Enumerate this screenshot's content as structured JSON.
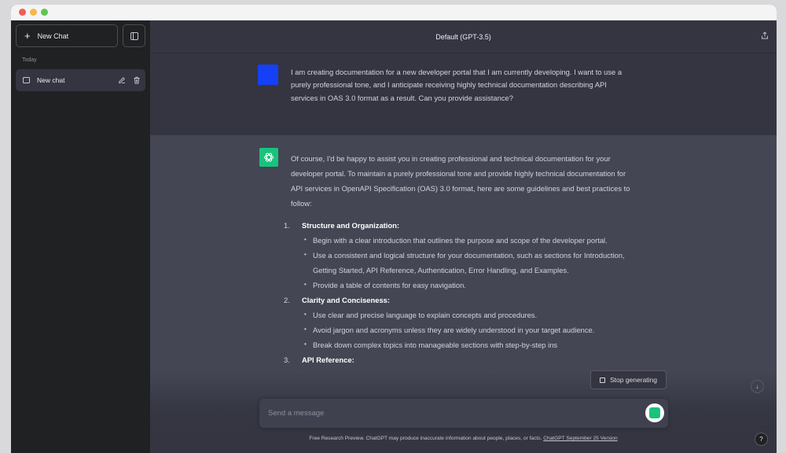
{
  "window": {
    "traffic_lights": [
      "close",
      "minimize",
      "zoom"
    ]
  },
  "sidebar": {
    "new_chat_label": "New Chat",
    "section_label": "Today",
    "chats": [
      {
        "label": "New chat"
      }
    ],
    "icons": {
      "new_chat": "plus-icon",
      "toggle": "sidebar-toggle-icon",
      "chat": "chat-bubble-icon",
      "edit": "pencil-icon",
      "delete": "trash-icon"
    }
  },
  "header": {
    "title": "Default (GPT-3.5)",
    "share_icon": "share-icon"
  },
  "conversation": {
    "user_message": "I am creating documentation for a new developer portal that I am currently developing. I want to use a purely professional tone, and I anticipate receiving highly technical documentation describing API services in OAS 3.0 format as a result. Can you provide assistance?",
    "assistant_intro": "Of course, I'd be happy to assist you in creating professional and technical documentation for your developer portal. To maintain a purely professional tone and provide highly technical documentation for API services in OpenAPI Specification (OAS) 3.0 format, here are some guidelines and best practices to follow:",
    "sections": [
      {
        "number": "1.",
        "heading": "Structure and Organization:",
        "bullets": [
          "Begin with a clear introduction that outlines the purpose and scope of the developer portal.",
          "Use a consistent and logical structure for your documentation, such as sections for Introduction, Getting Started, API Reference, Authentication, Error Handling, and Examples.",
          "Provide a table of contents for easy navigation."
        ]
      },
      {
        "number": "2.",
        "heading": "Clarity and Conciseness:",
        "bullets": [
          "Use clear and precise language to explain concepts and procedures.",
          "Avoid jargon and acronyms unless they are widely understood in your target audience.",
          "Break down complex topics into manageable sections with step-by-step ins"
        ]
      },
      {
        "number": "3.",
        "heading": "API Reference:",
        "bullets": []
      }
    ]
  },
  "controls": {
    "stop_label": "Stop generating",
    "composer_placeholder": "Send a message",
    "scroll_down_icon": "arrow-down-icon",
    "help_label": "?"
  },
  "footer": {
    "text": "Free Research Preview. ChatGPT may produce inaccurate information about people, places, or facts.",
    "link": "ChatGPT September 25 Version"
  },
  "colors": {
    "sidebar": "#202123",
    "main": "#343541",
    "assistant_bg": "#444654",
    "user_avatar": "#1540f5",
    "bot_avatar": "#19c37d"
  }
}
